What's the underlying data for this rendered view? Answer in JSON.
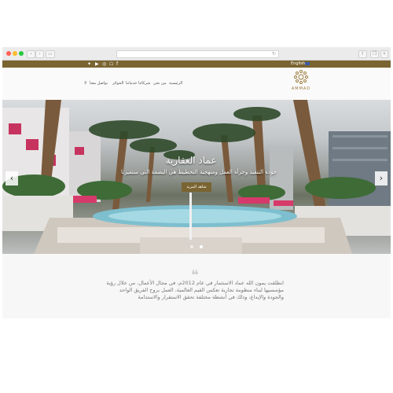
{
  "colors": {
    "brand": "#7a6431",
    "accent_pink": "#d63a6a",
    "page_bg": "#f7f7f7"
  },
  "browser": {
    "window_dots": [
      "#ff5f57",
      "#febc2e",
      "#28c840"
    ],
    "back_icon": "chevron-left-icon",
    "forward_icon": "chevron-right-icon",
    "reload_icon": "reload-icon"
  },
  "topbar": {
    "social_icons": [
      "twitter-icon",
      "youtube-icon",
      "instagram-icon",
      "snapchat-icon",
      "facebook-icon"
    ],
    "language": "English"
  },
  "nav": {
    "items": [
      "الرئيسية",
      "من نحن",
      "شركائنا",
      "خدماتنا",
      "الجوائز",
      "تواصل معنا"
    ],
    "search_icon": "search-icon"
  },
  "logo": {
    "text": "AMMAD"
  },
  "hero": {
    "title": "عماد العقارية",
    "subtitle": "جودة التنفيذ وجرأة العمل ومنهجية التخطيط هي البصمة التي ستميزنا",
    "button": "شاهد المزيد",
    "slides": 2,
    "active_slide": 2
  },
  "about": {
    "quote": "انطلقت يمون الله عماد الاستثمار في عام 2012م، في مجال الأعمال، من خلال رؤية مؤسسيها لبناء منظومة تجارية تعكس القيم العالمية، العمل بروح الفريق الواحد والجودة والإبداع، وذلك في أنشطة مختلفة تحقق الاستقرار والاستدامة"
  }
}
